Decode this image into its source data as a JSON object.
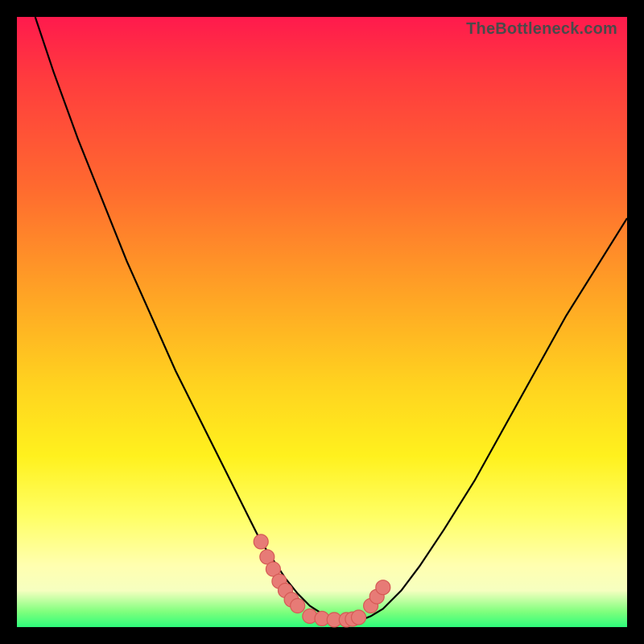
{
  "watermark": "TheBottleneck.com",
  "colors": {
    "frame": "#000000",
    "gradient_top": "#ff1a4d",
    "gradient_mid": "#ffd21f",
    "gradient_bottom": "#2dfc7a",
    "curve_stroke": "#000000",
    "marker_fill": "#e77b76",
    "marker_stroke": "#d55a55"
  },
  "chart_data": {
    "type": "line",
    "title": "",
    "xlabel": "",
    "ylabel": "",
    "xlim": [
      0,
      100
    ],
    "ylim": [
      0,
      100
    ],
    "grid": false,
    "legend": false,
    "series": [
      {
        "name": "bottleneck-curve",
        "x": [
          3,
          6,
          10,
          14,
          18,
          22,
          26,
          30,
          34,
          38,
          40,
          42,
          44,
          46,
          48,
          50,
          52,
          54,
          56,
          57,
          58,
          60,
          63,
          66,
          70,
          75,
          80,
          85,
          90,
          95,
          100
        ],
        "values": [
          100,
          91,
          80,
          70,
          60,
          51,
          42,
          34,
          26,
          18,
          14,
          11,
          8,
          5.5,
          3.5,
          2.2,
          1.5,
          1.2,
          1.2,
          1.4,
          1.8,
          3,
          6,
          10,
          16,
          24,
          33,
          42,
          51,
          59,
          67
        ]
      }
    ],
    "markers": [
      {
        "name": "left-cluster",
        "points": [
          {
            "x": 40,
            "y": 14
          },
          {
            "x": 41,
            "y": 11.5
          },
          {
            "x": 42,
            "y": 9.5
          },
          {
            "x": 43,
            "y": 7.5
          },
          {
            "x": 44,
            "y": 6
          },
          {
            "x": 45,
            "y": 4.5
          },
          {
            "x": 46,
            "y": 3.5
          }
        ]
      },
      {
        "name": "bottom-flat",
        "points": [
          {
            "x": 48,
            "y": 1.8
          },
          {
            "x": 50,
            "y": 1.4
          },
          {
            "x": 52,
            "y": 1.2
          },
          {
            "x": 54,
            "y": 1.2
          },
          {
            "x": 55,
            "y": 1.3
          },
          {
            "x": 56,
            "y": 1.6
          }
        ]
      },
      {
        "name": "right-cluster",
        "points": [
          {
            "x": 58,
            "y": 3.5
          },
          {
            "x": 59,
            "y": 5
          },
          {
            "x": 60,
            "y": 6.5
          }
        ]
      }
    ]
  }
}
